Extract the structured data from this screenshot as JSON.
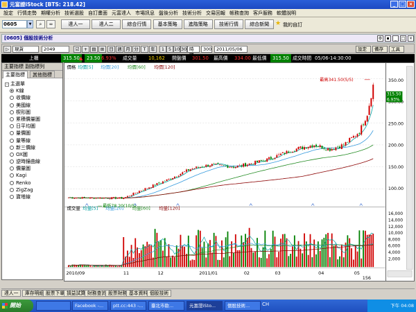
{
  "window": {
    "title": "元富證iStock [BTS: 218.42]"
  },
  "menu": [
    "設定",
    "行情走勢",
    "期權分析",
    "技術選股",
    "自訂畫面",
    "元富達人",
    "市場訊息",
    "盤後分析",
    "技術分析",
    "交易回報",
    "帳務查詢",
    "客戶服務",
    "軟體說明"
  ],
  "toolbar": {
    "symbol": "0605",
    "buttons": [
      "達人一",
      "達人二",
      "綜合行情",
      "基本策略",
      "進階策略",
      "技術行情",
      "綜合新聞"
    ],
    "favorites": "我的自訂"
  },
  "panel": {
    "title": "[0605] 個股技術分析"
  },
  "controls": {
    "mode": "現貨",
    "period": "2049",
    "intervals": [
      "日",
      "週",
      "月",
      "分",
      "T",
      "年"
    ],
    "minutes": [
      "1",
      "5",
      "10",
      "30"
    ],
    "tick": "時間",
    "bars": "300",
    "date": "2011/05/06",
    "right_buttons": [
      "設定",
      "備存",
      "工具"
    ]
  },
  "quote": {
    "dir_label": "上櫃",
    "last": "315.50",
    "chg": "23.50",
    "pct": "6.93%",
    "vol_label": "成交量",
    "vol": "10,162",
    "open_label": "開盤價",
    "open": "301.50",
    "high_label": "最高價",
    "high": "334.00",
    "low_label": "最低價",
    "low": "315.50",
    "time_label": "成交時間",
    "time": "05/06-14:30:00"
  },
  "sidebar": {
    "header": "主要指標 副指標列",
    "tabs": [
      "主要指標",
      "其他指標"
    ],
    "group": "主選單",
    "items": [
      "K線",
      "收價線",
      "美國線",
      "楔形圖",
      "累積價量圖",
      "日平均圖",
      "量價圖",
      "量等線",
      "新三價線",
      "OX圖",
      "逆時鐘曲線",
      "價量圖",
      "Kagi",
      "Renko",
      "ZigZag",
      "寶塔線"
    ],
    "selected": 0
  },
  "chart_data": {
    "type": "candlestick",
    "price_legend": {
      "label": "價格",
      "items": [
        {
          "name": "均價[5]",
          "color": "#00a0a0"
        },
        {
          "name": "均價[20]",
          "color": "#3399dd"
        },
        {
          "name": "均價[60]",
          "color": "#228b22"
        },
        {
          "name": "均價[120]",
          "color": "#8b0000"
        }
      ]
    },
    "volume_legend": {
      "label": "成交量",
      "items": [
        {
          "name": "均量[5]",
          "color": "#00a0a0"
        },
        {
          "name": "均量[20]",
          "color": "#3399dd"
        },
        {
          "name": "均量[60]",
          "color": "#228b22"
        },
        {
          "name": "均量[120]",
          "color": "#8b0000"
        }
      ]
    },
    "price_ticks": [
      100,
      150,
      200,
      250,
      300,
      350
    ],
    "volume_ticks": [
      2000,
      4000,
      6000,
      8000,
      10000,
      12000,
      14000,
      16000
    ],
    "price_ylim": [
      65,
      370
    ],
    "volume_ylim": [
      0,
      17000
    ],
    "x_labels": [
      "2010/09",
      "11",
      "12",
      "2011/01",
      "02",
      "03",
      "04",
      "05"
    ],
    "annotation_high": "最高341.50(5/5)",
    "annotation_low": "最低78.20(10/5)",
    "last_price": "315.50",
    "last_pct": "6.93%",
    "scroll_value": "156",
    "anchors": [
      {
        "i": 0,
        "p": 80
      },
      {
        "i": 28,
        "p": 79
      },
      {
        "i": 36,
        "p": 95
      },
      {
        "i": 50,
        "p": 120
      },
      {
        "i": 62,
        "p": 145
      },
      {
        "i": 72,
        "p": 155
      },
      {
        "i": 85,
        "p": 150
      },
      {
        "i": 100,
        "p": 165
      },
      {
        "i": 115,
        "p": 190
      },
      {
        "i": 125,
        "p": 200
      },
      {
        "i": 133,
        "p": 190
      },
      {
        "i": 140,
        "p": 200
      },
      {
        "i": 148,
        "p": 230
      },
      {
        "i": 152,
        "p": 270
      },
      {
        "i": 155,
        "p": 335
      }
    ]
  },
  "bottom_tabs": [
    "達人一",
    "庫存明細",
    "股票下單",
    "損益試算",
    "財務查詢",
    "股票財務",
    "基本資料",
    "個股技術"
  ],
  "taskbar": {
    "start": "開始",
    "tasks": [
      "Facebook -...",
      "ptt.cc:443 -...",
      "臺北市歐...",
      "元富證iSto...",
      "個股技術..."
    ],
    "lang": "CH",
    "clock": "下午 04:08"
  }
}
